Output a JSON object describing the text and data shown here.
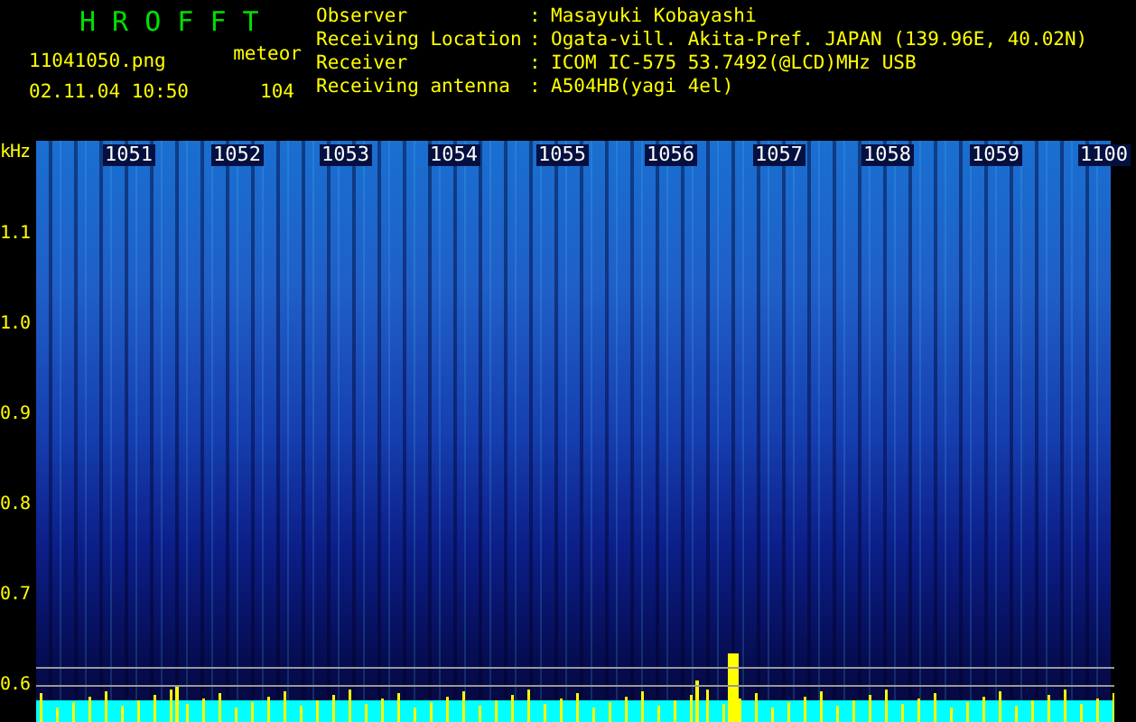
{
  "header": {
    "app_title": "H R O F F T",
    "file_name": "11041050.png",
    "date_time": "02.11.04 10:50",
    "count_label": "meteor",
    "count_value": "104"
  },
  "info": [
    {
      "label": "Observer",
      "separator": ":",
      "value": "Masayuki Kobayashi"
    },
    {
      "label": "Receiving Location",
      "separator": ":",
      "value": "Ogata-vill. Akita-Pref. JAPAN (139.96E, 40.02N)"
    },
    {
      "label": "Receiver",
      "separator": ":",
      "value": "ICOM IC-575 53.7492(@LCD)MHz USB"
    },
    {
      "label": "Receiving antenna",
      "separator": ":",
      "value": "A504HB(yagi 4el)"
    }
  ],
  "plot": {
    "unit": "kHz",
    "y_labels": [
      "1.1",
      "1.0",
      "0.9",
      "0.8",
      "0.7",
      "0.6"
    ],
    "time_labels": [
      "1051",
      "1052",
      "1053",
      "1054",
      "1055",
      "1056",
      "1057",
      "1058",
      "1059",
      "1100"
    ]
  }
}
